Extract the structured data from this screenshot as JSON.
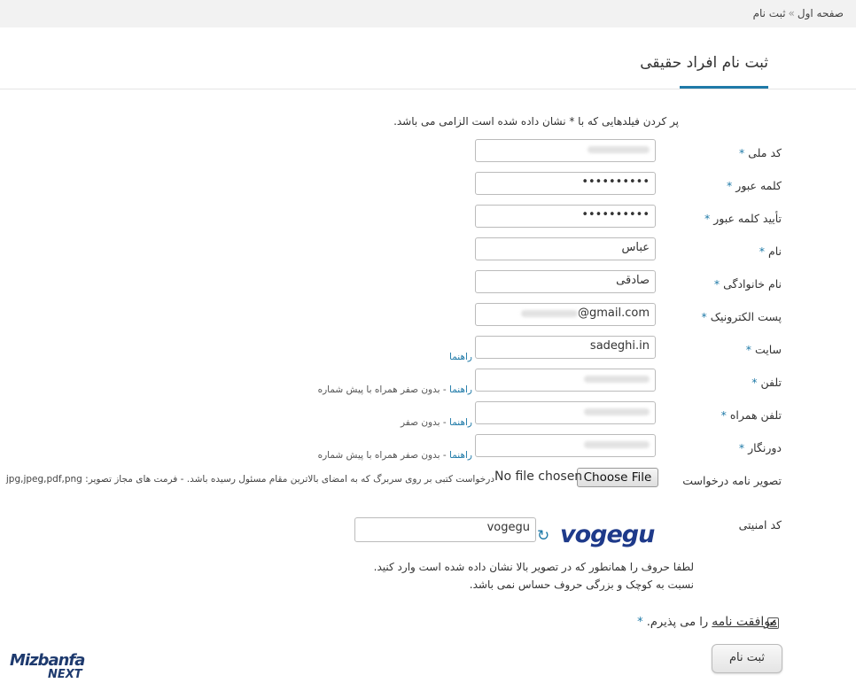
{
  "breadcrumb": {
    "home": "صفحه اول",
    "separator": "»",
    "current": "ثبت نام"
  },
  "page_title": "ثبت نام افراد حقیقی",
  "required_note": "پر کردن فیلدهایی که با * نشان داده شده است الزامی می باشد.",
  "required_marker": "*",
  "fields": {
    "national_code": {
      "label": "کد ملی",
      "value": ""
    },
    "password": {
      "label": "کلمه عبور",
      "value": "••••••••••"
    },
    "password_confirm": {
      "label": "تأیید کلمه عبور",
      "value": "••••••••••"
    },
    "first_name": {
      "label": "نام",
      "value": "عباس"
    },
    "last_name": {
      "label": "نام خانوادگی",
      "value": "صادقی"
    },
    "email": {
      "label": "پست الکترونیک",
      "value": "@gmail.com"
    },
    "website": {
      "label": "سایت",
      "value": "sadeghi.in",
      "hint_link": "راهنما"
    },
    "phone": {
      "label": "تلفن",
      "value": "",
      "hint_link": "راهنما",
      "hint_text": " - بدون صفر همراه با پیش شماره"
    },
    "mobile": {
      "label": "تلفن همراه",
      "value": "",
      "hint_link": "راهنما",
      "hint_text": " - بدون صفر"
    },
    "fax": {
      "label": "دورنگار",
      "value": "",
      "hint_link": "راهنما",
      "hint_text": " - بدون صفر همراه با پیش شماره"
    },
    "request_letter": {
      "label": "تصویر نامه درخواست",
      "button": "Choose File",
      "status": "No file chosen",
      "note": "درخواست کتبی بر روی سربرگ که به امضای بالاترین مقام مسئول رسیده باشد. - فرمت های مجاز تصویر: jpg,jpeg,pdf,png"
    },
    "captcha": {
      "label": "کد امنیتی",
      "value": "vogegu",
      "image_text": "vogegu",
      "message_line1": "لطفا حروف را همانطور که در تصویر بالا نشان داده شده است وارد کنید.",
      "message_line2": "نسبت به کوچک و بزرگی حروف حساس نمی باشد."
    }
  },
  "agreement": {
    "link": "موافقت نامه",
    "text": " را می پذیرم.",
    "checked": true
  },
  "submit_label": "ثبت نام",
  "logo": {
    "line1": "Mizbanfa",
    "line2": "NEXT"
  },
  "colors": {
    "accent": "#1f7aa8",
    "captcha": "#1e3a8a"
  }
}
